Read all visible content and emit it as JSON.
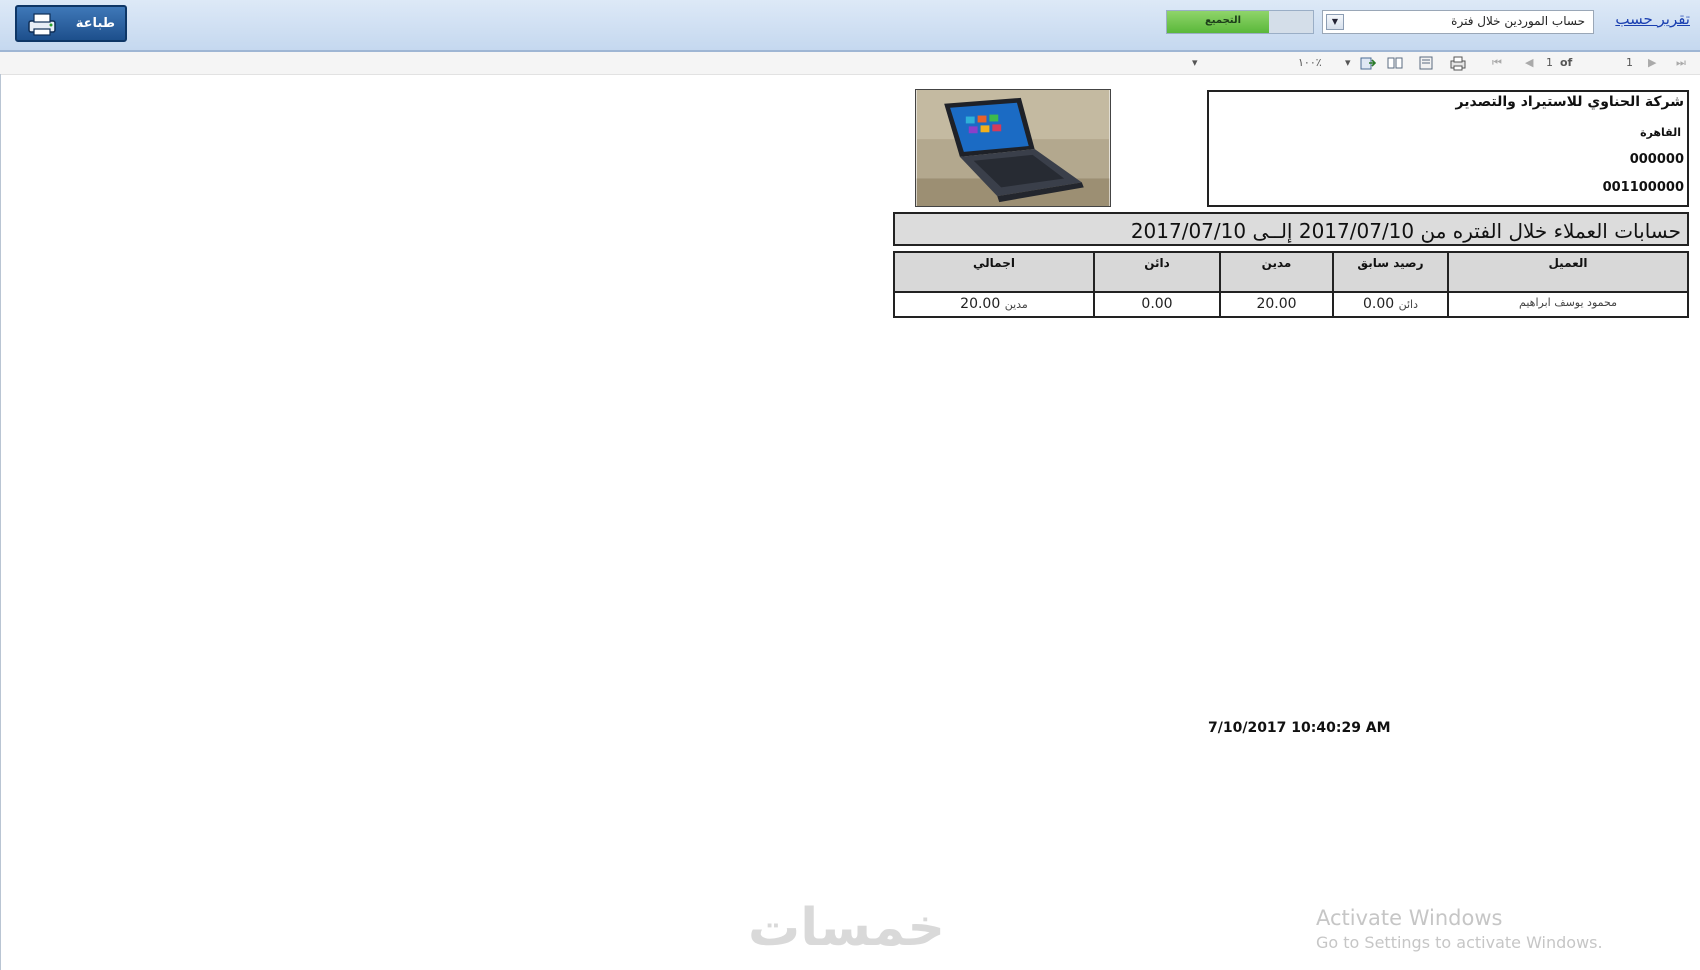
{
  "topbar": {
    "print_label": "طباعة",
    "report_link": "تقرير حسب",
    "report_select_value": "حساب الموردين خلال فترة",
    "progress_label": "التجميع",
    "progress_value": 0.7
  },
  "toolbar": {
    "page_current": "1",
    "page_of": "of",
    "page_total": "1",
    "zoom": "١٠٠٪"
  },
  "company": {
    "name": "شركة الحناوي للاستيراد والتصدير",
    "city": "القاهرة",
    "phone": "000000",
    "mobile": "001100000"
  },
  "report": {
    "title": "حسابات العملاء خلال الفتره من 2017/07/10 إلــى 2017/07/10"
  },
  "table": {
    "headers": {
      "customer": "العميل",
      "prev_balance": "رصيد سابق",
      "debit": "مدين",
      "credit": "دائن",
      "total": "اجمالي"
    },
    "rows": [
      {
        "customer": "محمود يوسف ابراهيم",
        "prev_balance": "0.00",
        "prev_balance_type": "دائن",
        "debit": "20.00",
        "credit": "0.00",
        "total": "20.00",
        "total_type": "مدين"
      }
    ]
  },
  "footer": {
    "timestamp": "7/10/2017 10:40:29 AM"
  },
  "overlays": {
    "watermark": "خمسات",
    "activate_title": "Activate Windows",
    "activate_sub": "Go to Settings to activate Windows."
  }
}
